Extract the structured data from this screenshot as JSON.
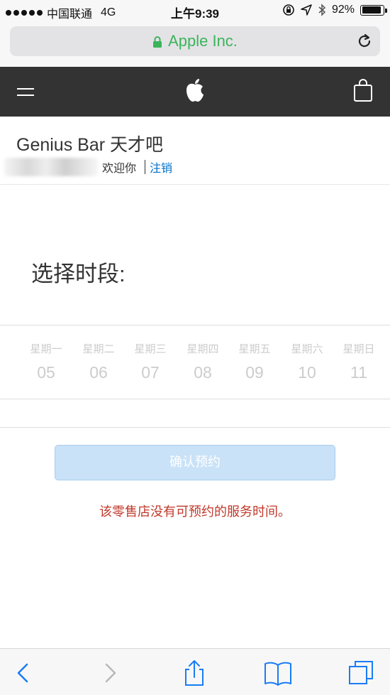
{
  "status_bar": {
    "carrier": "中国联通",
    "network": "4G",
    "time": "上午9:39",
    "battery": "92%",
    "battery_level": 0.92
  },
  "browser": {
    "url_title": "Apple Inc."
  },
  "page": {
    "title": "Genius Bar 天才吧",
    "welcome": "欢迎你",
    "signout": "注销",
    "choose_label": "选择时段:",
    "days": [
      {
        "weekday": "星期一",
        "date": "05"
      },
      {
        "weekday": "星期二",
        "date": "06"
      },
      {
        "weekday": "星期三",
        "date": "07"
      },
      {
        "weekday": "星期四",
        "date": "08"
      },
      {
        "weekday": "星期五",
        "date": "09"
      },
      {
        "weekday": "星期六",
        "date": "10"
      },
      {
        "weekday": "星期日",
        "date": "11"
      }
    ],
    "confirm": "确认预约",
    "error": "该零售店没有可预约的服务时间。"
  },
  "colors": {
    "nav_bg": "#333333",
    "link": "#0070c9",
    "error": "#c0392b",
    "url": "#3cb45a",
    "button_disabled": "#c9e2f7"
  }
}
